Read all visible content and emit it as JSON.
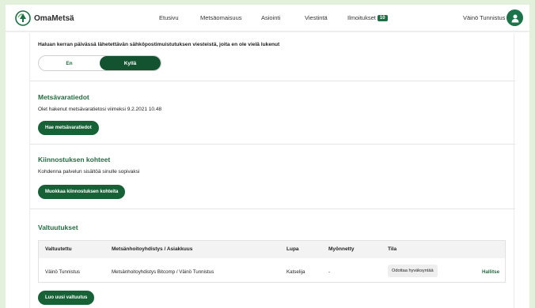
{
  "colors": {
    "brand": "#1c6f45",
    "button": "#166236",
    "heading": "#236b40",
    "background": "#e3f0dc"
  },
  "header": {
    "logo_text": "OmaMetsä",
    "nav": [
      {
        "label": "Etusivu"
      },
      {
        "label": "Metsäomaisuus"
      },
      {
        "label": "Asiointi"
      },
      {
        "label": "Viestintä"
      },
      {
        "label": "Ilmoitukset",
        "badge": "10"
      }
    ],
    "user_name": "Väinö Tunnistus",
    "avatar_icon": "user-icon"
  },
  "notifications": {
    "question": "Haluan kerran päivässä lähetettävän sähköpostimuistutuksen viesteistä, joita en ole vielä lukenut",
    "options": [
      "En",
      "Kyllä"
    ],
    "selected": "Kyllä"
  },
  "forest_data": {
    "title": "Metsävaratiedot",
    "description": "Olet hakenut metsävaratietosi viimeksi 9.2.2021 10.48",
    "button": "Hae metsävaratiedot"
  },
  "interests": {
    "title": "Kiinnostuksen kohteet",
    "description": "Kohdenna palvelun sisältöä sinulle sopivaksi",
    "button": "Muokkaa kiinnostuksen kohteita"
  },
  "authorizations": {
    "title": "Valtuutukset",
    "columns": [
      "Valtuutettu",
      "Metsänhoitoyhdistys / Asiakkuus",
      "Lupa",
      "Myönnetty",
      "Tila"
    ],
    "rows": [
      {
        "authorized": "Väinö Tunnistus",
        "association": "Metsänhoitoyhdistys Bitcomp / Väinö Tunnistus",
        "permission": "Katselija",
        "granted": "-",
        "status": "Odottaa hyväksyntää",
        "action": "Hallitse"
      }
    ],
    "button": "Luo uusi valtuutus"
  }
}
